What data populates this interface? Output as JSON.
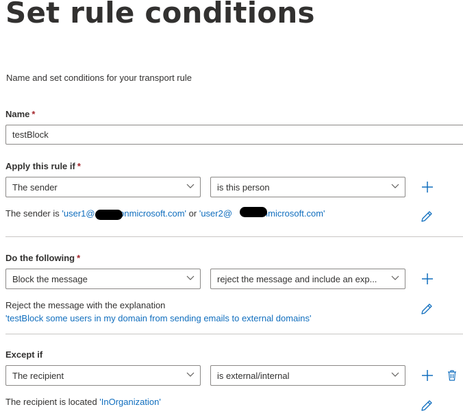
{
  "page": {
    "title": "Set rule conditions",
    "subtitle": "Name and set conditions for your transport rule"
  },
  "name_field": {
    "label": "Name",
    "required_mark": "*",
    "value": "testBlock"
  },
  "apply_rule": {
    "label": "Apply this rule if",
    "required_mark": "*",
    "condition_select": "The sender",
    "operator_select": "is this person",
    "summary_prefix": "The sender is ",
    "summary_value_1": "'user1@",
    "summary_value_1_tail": ".onmicrosoft.com'",
    "summary_connector": " or ",
    "summary_value_2": "'user2@",
    "summary_value_2_tail": ".onmicrosoft.com'"
  },
  "do_following": {
    "label": "Do the following",
    "required_mark": "*",
    "action_select": "Block the message",
    "detail_select": "reject the message and include an exp...",
    "summary_line1": "Reject the message with the explanation",
    "summary_line2": "'testBlock some users in my domain from sending emails to external domains'"
  },
  "except_if": {
    "label": "Except if",
    "condition_select": "The recipient",
    "operator_select": "is external/internal",
    "summary_prefix": "The recipient is located ",
    "summary_value": "'InOrganization'"
  },
  "colors": {
    "accent": "#106ebe",
    "required": "#a4262c",
    "border": "#8a8886",
    "divider": "#c8c6c4",
    "text": "#323130"
  },
  "icons": {
    "add": "plus-icon",
    "edit": "pencil-icon",
    "delete": "trash-icon",
    "dropdown": "chevron-down-icon"
  }
}
